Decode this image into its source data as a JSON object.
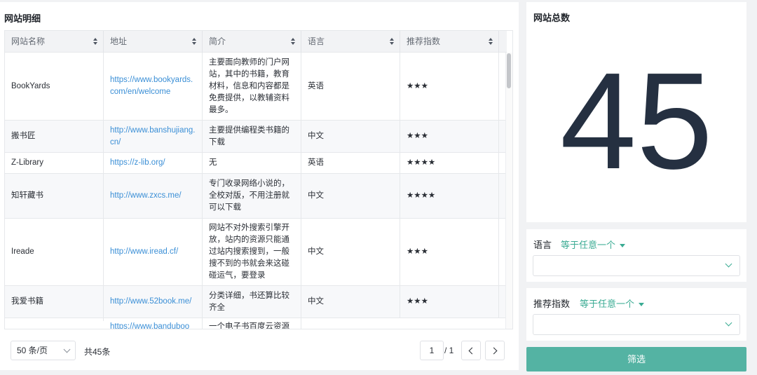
{
  "detail": {
    "title": "网站明细",
    "columns": [
      "网站名称",
      "地址",
      "简介",
      "语言",
      "推荐指数"
    ],
    "rows": [
      {
        "name": "BookYards",
        "url": "https://www.bookyards.com/en/welcome",
        "desc": "主要面向教师的门户网站，其中的书籍，教育材料，信息和内容都是免费提供，以教辅资料最多。",
        "lang": "英语",
        "stars": "★★★"
      },
      {
        "name": "搬书匠",
        "url": "http://www.banshujiang.cn/",
        "desc": "主要提供编程类书籍的下载",
        "lang": "中文",
        "stars": "★★★"
      },
      {
        "name": "Z-Library",
        "url": "https://z-lib.org/",
        "desc": "无",
        "lang": "英语",
        "stars": "★★★★"
      },
      {
        "name": "知轩藏书",
        "url": "http://www.zxcs.me/",
        "desc": "专门收录网络小说的，全校对版，不用注册就可以下载",
        "lang": "中文",
        "stars": "★★★★"
      },
      {
        "name": "Ireade",
        "url": "http://www.iread.cf/",
        "desc": "网站不对外搜索引擎开放，站内的资源只能通过站内搜索搜到，一般搜不到的书就会来这碰碰运气，要登录",
        "lang": "中文",
        "stars": "★★★"
      },
      {
        "name": "我爱书籍",
        "url": "http://www.52book.me/",
        "desc": "分类详细，书还算比较齐全",
        "lang": "中文",
        "stars": "★★★"
      },
      {
        "name": "",
        "url": "https://www.banduboo",
        "desc": "一个电子书百度云资源",
        "lang": "",
        "stars": ""
      }
    ],
    "pager": {
      "page_size": "50 条/页",
      "total": "共45条",
      "current_page": "1",
      "of_pages": "/ 1"
    }
  },
  "summary": {
    "title": "网站总数",
    "count": "45"
  },
  "filters": {
    "language": {
      "label": "语言",
      "operator": "等于任意一个",
      "value": ""
    },
    "score": {
      "label": "推荐指数",
      "operator": "等于任意一个",
      "value": ""
    }
  },
  "filter_button": "筛选",
  "colors": {
    "accent": "#54b3a3",
    "link": "#3b8fd6",
    "number": "#253041"
  }
}
